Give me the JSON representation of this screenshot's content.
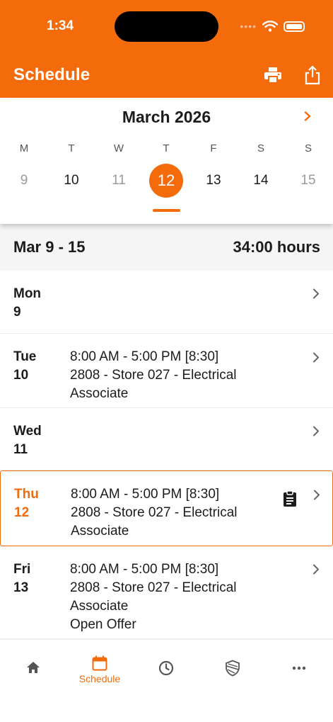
{
  "status_bar": {
    "time": "1:34",
    "signal": "••••"
  },
  "header": {
    "title": "Schedule"
  },
  "calendar": {
    "month": "March 2026",
    "weekdays": [
      "M",
      "T",
      "W",
      "T",
      "F",
      "S",
      "S"
    ],
    "days": [
      "9",
      "10",
      "11",
      "12",
      "13",
      "14",
      "15"
    ],
    "selected_day": "12"
  },
  "week": {
    "range": "Mar 9 - 15",
    "hours": "34:00 hours"
  },
  "schedule": [
    {
      "day": "Mon",
      "date": "9"
    },
    {
      "day": "Tue",
      "date": "10",
      "shift": "8:00 AM - 5:00 PM [8:30]",
      "job_line1": "2808 - Store 027 - Electrical",
      "job_line2": "Associate"
    },
    {
      "day": "Wed",
      "date": "11"
    },
    {
      "day": "Thu",
      "date": "12",
      "shift": "8:00 AM - 5:00 PM [8:30]",
      "job_line1": "2808 - Store 027 - Electrical",
      "job_line2": "Associate"
    },
    {
      "day": "Fri",
      "date": "13",
      "shift": "8:00 AM - 5:00 PM [8:30]",
      "job_line1": "2808 - Store 027 - Electrical",
      "job_line2": "Associate",
      "note": "Open Offer"
    }
  ],
  "tabs": {
    "schedule_label": "Schedule"
  },
  "colors": {
    "accent": "#f46b0c",
    "text": "#1c1c1e",
    "muted": "#9a9a9a"
  },
  "icons": [
    "print-icon",
    "share-icon",
    "chevron-right-icon",
    "clipboard-icon",
    "home-icon",
    "calendar-icon",
    "clock-icon",
    "shield-icon",
    "more-icon"
  ]
}
